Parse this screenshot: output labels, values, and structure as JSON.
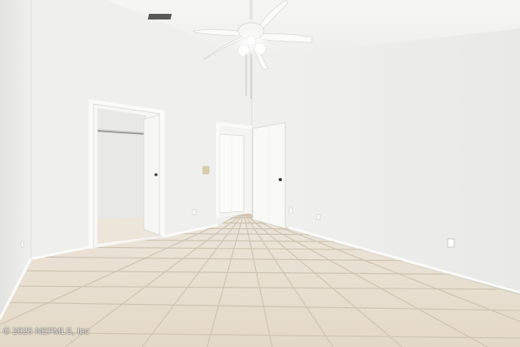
{
  "photo": {
    "watermark": "© 2025 NEFMLS, Inc"
  },
  "colors": {
    "wall_left": "#ececea",
    "wall_back": "#f2f2f0",
    "wall_right": "#eeeeec",
    "ceiling": "#f4f4f2",
    "floor_tile": "#e6dccd",
    "grout": "#c9bdab"
  }
}
